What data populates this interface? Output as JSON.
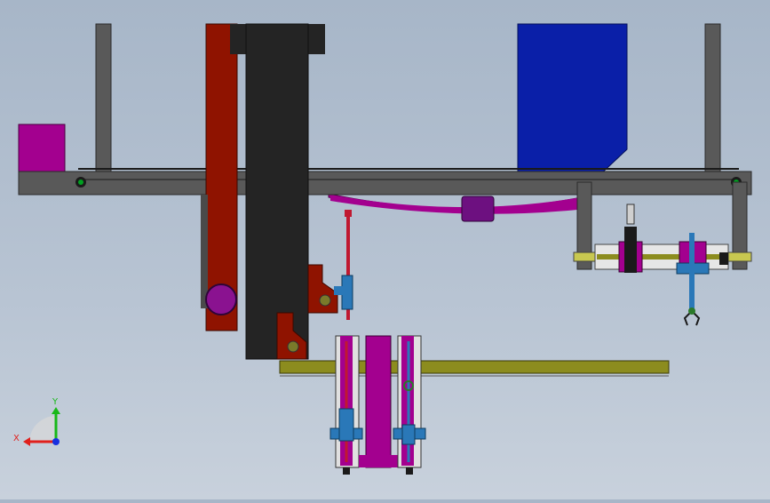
{
  "window": {
    "title": ""
  },
  "viewport": {
    "background_top": "#a7b6c8",
    "background_bottom": "#c8d1dc"
  },
  "colors": {
    "frame_gray": "#595959",
    "frame_dark": "#3a3a3a",
    "red_column": "#8f1300",
    "black_column": "#242424",
    "blue_block": "#0a1fa8",
    "magenta": "#a3008f",
    "purple": "#7a1a8a",
    "olive_rail": "#8c8c1e",
    "steel_blue": "#2a78b8",
    "green_dot": "#00a020"
  },
  "triad": {
    "x_label": "X",
    "y_label": "Y",
    "x_color": "#e0201c",
    "y_color": "#18b818",
    "z_color": "#1830e0"
  }
}
